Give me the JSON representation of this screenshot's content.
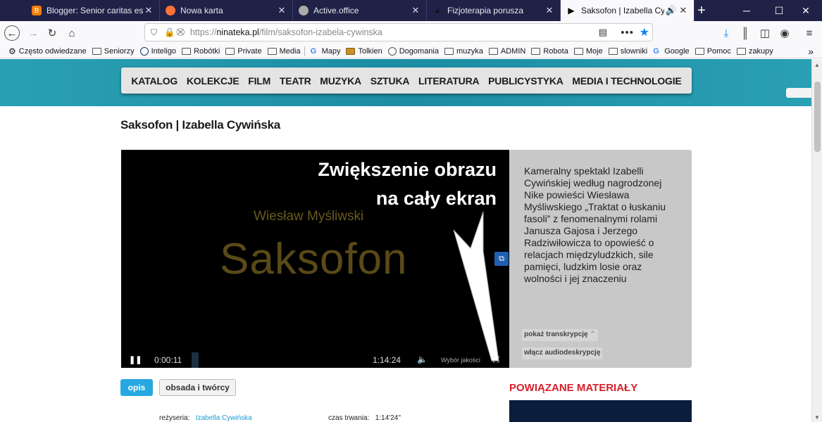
{
  "tabs": [
    {
      "label": "Blogger: Senior caritas est - Ed",
      "icon": "blogger-icon",
      "color": "#f57d00"
    },
    {
      "label": "Nowa karta",
      "icon": "firefox-icon",
      "color": "#ff7139"
    },
    {
      "label": "Active.office",
      "icon": "activeoffice-icon",
      "color": "#888888"
    },
    {
      "label": "Fizjoterapia porusza",
      "icon": "fizjo-icon",
      "color": "#222222"
    },
    {
      "label": "Saksofon | Izabella Cywińsk",
      "icon": "play-icon",
      "color": "#000000"
    }
  ],
  "url": {
    "prefix": "https://",
    "host": "ninateka.pl",
    "path": "/film/saksofon-izabela-cywinska"
  },
  "bookmarks": [
    {
      "label": "Często odwiedzane",
      "icon": "gear-icon"
    },
    {
      "label": "Seniorzy",
      "icon": "folder-icon"
    },
    {
      "label": "Inteligo",
      "icon": "globe-icon"
    },
    {
      "label": "Robótki",
      "icon": "folder-icon"
    },
    {
      "label": "Private",
      "icon": "folder-icon"
    },
    {
      "label": "Media",
      "icon": "folder-icon"
    },
    {
      "label": "Mapy",
      "icon": "google-icon"
    },
    {
      "label": "Tolkien",
      "icon": "tolkien-icon"
    },
    {
      "label": "Dogomania",
      "icon": "globe-icon"
    },
    {
      "label": "muzyka",
      "icon": "folder-icon"
    },
    {
      "label": "ADMIN",
      "icon": "folder-icon"
    },
    {
      "label": "Robota",
      "icon": "folder-icon"
    },
    {
      "label": "Moje",
      "icon": "folder-icon"
    },
    {
      "label": "slowniki",
      "icon": "folder-icon"
    },
    {
      "label": "Google",
      "icon": "google-icon"
    },
    {
      "label": "Pomoc",
      "icon": "folder-icon"
    },
    {
      "label": "zakupy",
      "icon": "folder-icon"
    }
  ],
  "menu": [
    "KATALOG",
    "KOLEKCJE",
    "FILM",
    "TEATR",
    "MUZYKA",
    "SZTUKA",
    "LITERATURA",
    "PUBLICYSTYKA",
    "MEDIA I TECHNOLOGIE"
  ],
  "page_title": "Saksofon | Izabella Cywińska",
  "player": {
    "annotation_line1": "Zwiększenie obrazu",
    "annotation_line2": "na cały ekran",
    "film_author": "Wiesław Myśliwski",
    "film_title": "Saksofon",
    "current_time": "0:00:11",
    "duration": "1:14:24",
    "quality_label": "Wybór jakości"
  },
  "description": "Kameralny spektakl Izabelli Cywińskiej według nagrodzonej Nike powieści Wiesława Myśliwskiego „Traktat o łuskaniu fasoli” z fenomenalnymi rolami Janusza Gajosa i Jerzego Radziwiłowicza to opowieść o relacjach międzyludzkich, sile pamięci, ludzkim losie oraz wolności i jej znaczeniu",
  "desc_buttons": {
    "transcript": "pokaż transkrypcję",
    "audiodesc": "włącz audiodeskrypcję"
  },
  "content_tabs": {
    "opis": "opis",
    "cast": "obsada i twórcy"
  },
  "related_heading": "POWIĄZANE MATERIAŁY",
  "meta": {
    "director_label": "reżyseria:",
    "director_value": "Izabella Cywińska",
    "duration_label": "czas trwania:",
    "duration_value": "1:14'24''"
  }
}
